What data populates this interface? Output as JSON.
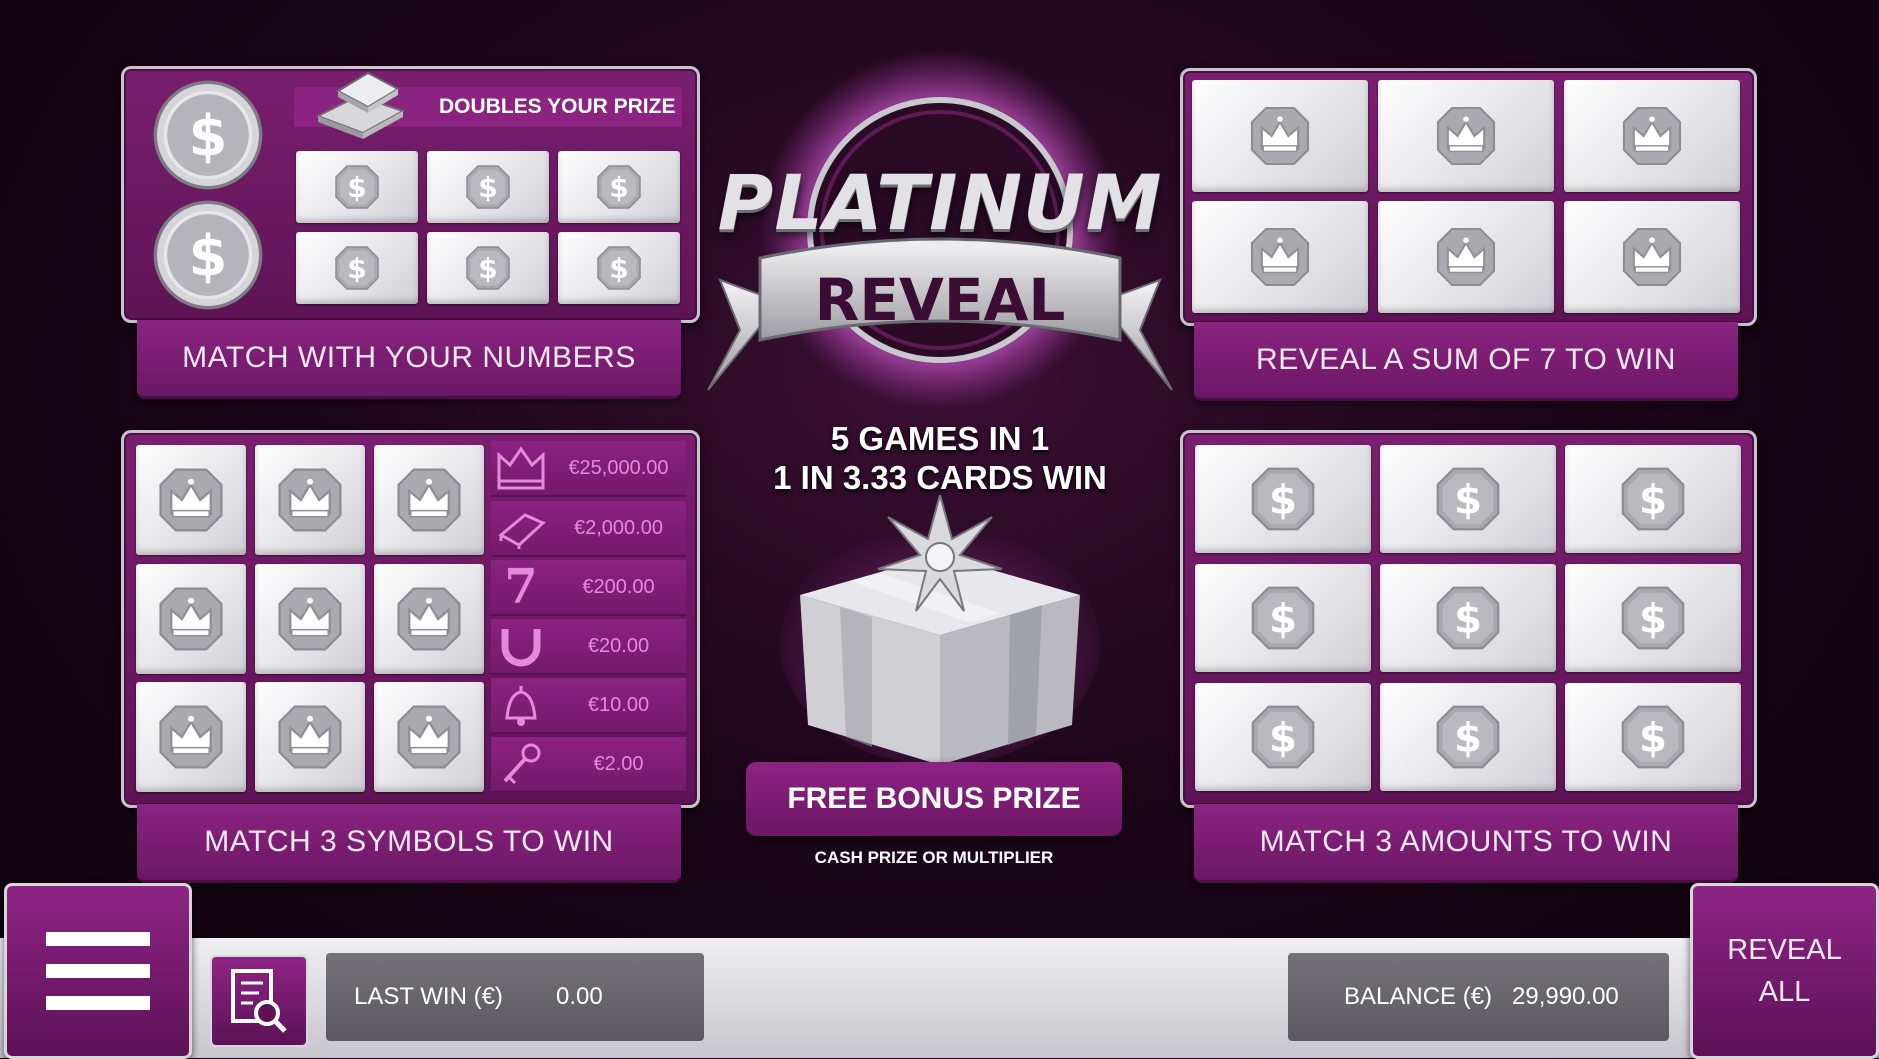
{
  "logo": {
    "title": "PLATINUM",
    "subtitle": "REVEAL"
  },
  "tagline": {
    "line1": "5 GAMES IN 1",
    "line2": "1 IN 3.33 CARDS WIN"
  },
  "bonus": {
    "button_label": "FREE BONUS PRIZE",
    "caption": "CASH PRIZE OR MULTIPLIER"
  },
  "game1": {
    "doubles_label": "DOUBLES YOUR PRIZE",
    "label": "MATCH WITH YOUR NUMBERS",
    "winning_symbols": 2,
    "your_symbols": 6,
    "icon": "dollar-icon"
  },
  "game2": {
    "label": "REVEAL A SUM OF 7 TO WIN",
    "tiles": 6,
    "icon": "crown-icon"
  },
  "game3": {
    "label": "MATCH 3 SYMBOLS TO WIN",
    "tiles": 9,
    "icon": "crown-icon",
    "prizes": [
      {
        "icon": "crown-icon",
        "value": "€25,000.00"
      },
      {
        "icon": "gold-bar-icon",
        "value": "€2,000.00"
      },
      {
        "icon": "seven-icon",
        "value": "€200.00"
      },
      {
        "icon": "horseshoe-icon",
        "value": "€20.00"
      },
      {
        "icon": "bell-icon",
        "value": "€10.00"
      },
      {
        "icon": "key-icon",
        "value": "€2.00"
      }
    ]
  },
  "game4": {
    "label": "MATCH 3 AMOUNTS TO WIN",
    "tiles": 9,
    "icon": "dollar-icon"
  },
  "footer": {
    "last_win_label": "LAST WIN (€)",
    "last_win_value": "0.00",
    "balance_label": "BALANCE (€)",
    "balance_value": "29,990.00",
    "reveal_all_line1": "REVEAL",
    "reveal_all_line2": "ALL"
  },
  "colors": {
    "accent": "#7a1f70",
    "prize_text": "#e38ad8",
    "background": "#1c0619"
  }
}
